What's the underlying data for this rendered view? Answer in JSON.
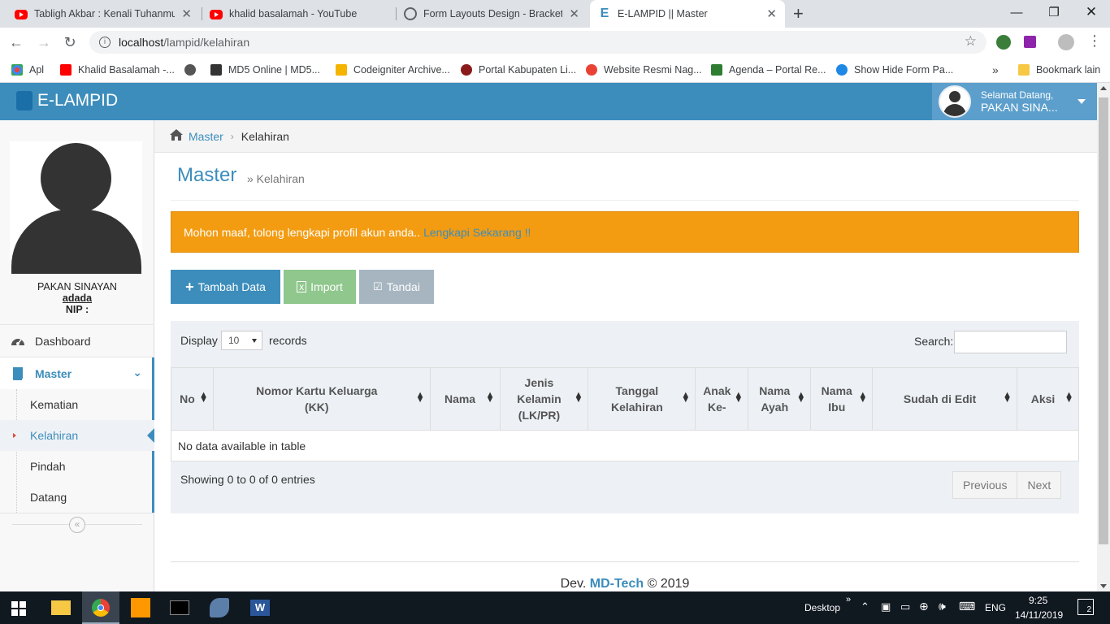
{
  "browser": {
    "tabs": [
      {
        "title": "Tabligh Akbar : Kenali Tuhanmu, I",
        "icon": "youtube-icon"
      },
      {
        "title": "khalid basalamah - YouTube",
        "icon": "youtube-icon"
      },
      {
        "title": "Form Layouts Design - Bracket Re",
        "icon": "globe-icon"
      },
      {
        "title": "E-LAMPID || Master",
        "icon": "elampid-icon"
      }
    ],
    "new_tab": "+",
    "url_host": "localhost",
    "url_path": "/lampid/kelahiran",
    "bookmarks": [
      {
        "label": "Apl",
        "color": "#ea4335"
      },
      {
        "label": "Khalid Basalamah -...",
        "color": "#ff0000"
      },
      {
        "label": "",
        "color": "#555555"
      },
      {
        "label": "MD5 Online | MD5...",
        "color": "#333333"
      },
      {
        "label": "Codeigniter Archive...",
        "color": "#f4b400"
      },
      {
        "label": "Portal Kabupaten Li...",
        "color": "#8b1a1a"
      },
      {
        "label": "Website Resmi Nag...",
        "color": "#e94235"
      },
      {
        "label": "Agenda – Portal Re...",
        "color": "#2e7d32"
      },
      {
        "label": "Show Hide Form Pa...",
        "color": "#1e88e5"
      }
    ],
    "bookmarks_more": "»",
    "bookmark_other": "Bookmark lain"
  },
  "app": {
    "brand": "E-LAMPID",
    "welcome": "Selamat Datang,",
    "user_short": "PAKAN SINA...",
    "accent": "#3c8dbc"
  },
  "sidebar": {
    "user_name": "PAKAN SINAYAN",
    "user_sub": "adada",
    "nip": "NIP :",
    "menu": {
      "dashboard": "Dashboard",
      "master": "Master",
      "sub": [
        "Kematian",
        "Kelahiran",
        "Pindah",
        "Datang"
      ]
    },
    "collapse": "«"
  },
  "breadcrumb": {
    "home": "Master",
    "current": "Kelahiran"
  },
  "page": {
    "title": "Master",
    "subtitle": "» Kelahiran",
    "alert_text": "Mohon maaf, tolong lengkapi profil akun anda..",
    "alert_link": "Lengkapi Sekarang !!",
    "buttons": {
      "add": "Tambah Data",
      "import": "Import",
      "tandai": "Tandai"
    }
  },
  "table": {
    "display_label": "Display",
    "length_value": "10",
    "records_label": "records",
    "search_label": "Search:",
    "columns": [
      {
        "l1": "No",
        "l2": "",
        "l3": ""
      },
      {
        "l1": "Nomor Kartu Keluarga",
        "l2": "(KK)",
        "l3": ""
      },
      {
        "l1": "Nama",
        "l2": "",
        "l3": ""
      },
      {
        "l1": "Jenis",
        "l2": "Kelamin",
        "l3": "(LK/PR)"
      },
      {
        "l1": "Tanggal",
        "l2": "Kelahiran",
        "l3": ""
      },
      {
        "l1": "Anak",
        "l2": "Ke-",
        "l3": ""
      },
      {
        "l1": "Nama",
        "l2": "Ayah",
        "l3": ""
      },
      {
        "l1": "Nama",
        "l2": "Ibu",
        "l3": ""
      },
      {
        "l1": "Sudah di Edit",
        "l2": "",
        "l3": ""
      },
      {
        "l1": "Aksi",
        "l2": "",
        "l3": ""
      }
    ],
    "empty": "No data available in table",
    "info": "Showing 0 to 0 of 0 entries",
    "prev": "Previous",
    "next": "Next"
  },
  "footer": {
    "prefix": "Dev.",
    "brand": "MD-Tech",
    "suffix": "© 2019"
  },
  "taskbar": {
    "desktop": "Desktop",
    "lang": "ENG",
    "time": "9:25",
    "date": "14/11/2019",
    "notif": "2"
  }
}
